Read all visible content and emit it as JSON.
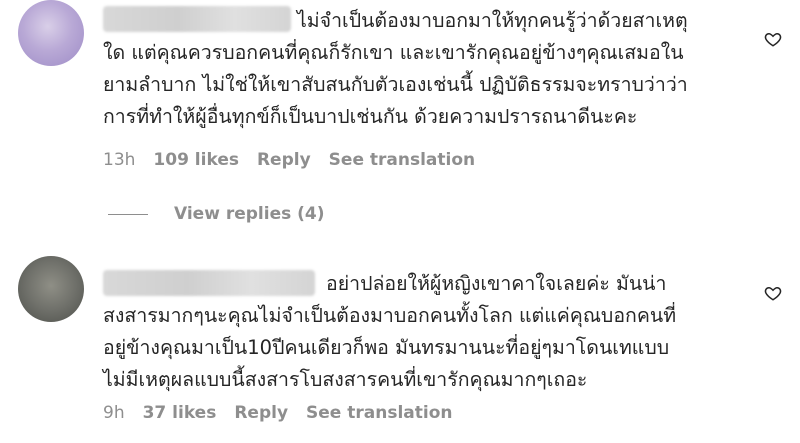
{
  "comments": [
    {
      "lines": [
        "ไม่จำเป็นต้องมาบอกมาให้ทุกคนรู้ว่าด้วยสาเหตุ",
        "ใด แต่คุณควรบอกคนที่คุณก็รักเขา และเขารักคุณอยู่ข้างๆคุณเสมอใน",
        "ยามลำบาก ไม่ใช่ให้เขาสับสนกับตัวเองเช่นนี้ ปฏิบัติธรรมจะทราบว่าว่า",
        "การที่ทำให้ผู้อื่นทุกข์ก็เป็นบาปเช่นกัน ด้วยความปรารถนาดีนะคะ"
      ],
      "time": "13h",
      "likes": "109 likes",
      "reply": "Reply",
      "translate": "See translation",
      "view_replies": "View replies (4)"
    },
    {
      "lines": [
        "อย่าปล่อยให้ผู้หญิงเขาคาใจเลยค่ะ มันน่า",
        "สงสารมากๆนะคุณไม่จำเป็นต้องมาบอกคนทั้งโลก แต่แค่คุณบอกคนที่",
        "อยู่ข้างคุณมาเป็น10ปีคนเดียวก็พอ มันทรมานนะที่อยู่ๆมาโดนเทแบบ",
        "ไม่มีเหตุผลแบบนี้สงสารโบสงสารคนที่เขารักคุณมากๆเถอะ"
      ],
      "time": "9h",
      "likes": "37 likes",
      "reply": "Reply",
      "translate": "See translation"
    }
  ],
  "icons": {
    "like": "heart-outline-icon"
  },
  "colors": {
    "text": "#262626",
    "muted": "#8e8e8e"
  }
}
